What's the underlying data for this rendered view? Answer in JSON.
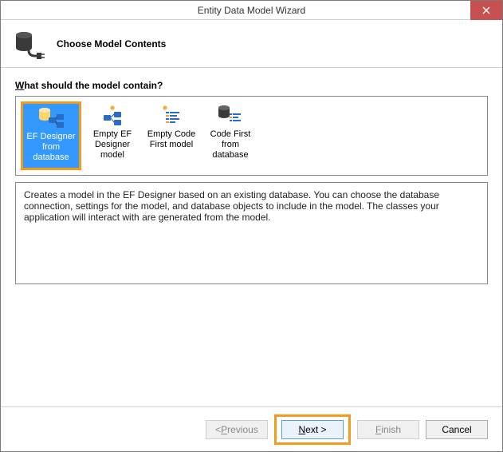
{
  "window": {
    "title": "Entity Data Model Wizard"
  },
  "header": {
    "title": "Choose Model Contents"
  },
  "prompt": {
    "pre": "W",
    "rest": "hat should the model contain?"
  },
  "options": [
    {
      "label": "EF Designer from database",
      "selected": true
    },
    {
      "label": "Empty EF Designer model",
      "selected": false
    },
    {
      "label": "Empty Code First model",
      "selected": false
    },
    {
      "label": "Code First from database",
      "selected": false
    }
  ],
  "description": "Creates a model in the EF Designer based on an existing database. You can choose the database connection, settings for the model, and database objects to include in the model. The classes your application will interact with are generated from the model.",
  "buttons": {
    "previous_pre": "< ",
    "previous_ul": "P",
    "previous_rest": "revious",
    "next_ul": "N",
    "next_rest": "ext >",
    "finish_ul": "F",
    "finish_rest": "inish",
    "cancel": "Cancel"
  }
}
